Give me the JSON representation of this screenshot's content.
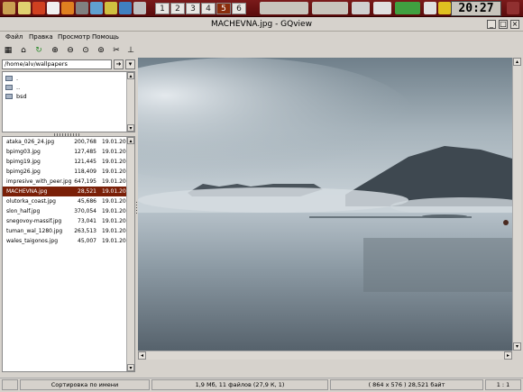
{
  "window_title": "MACHEVNA.jpg - GQview",
  "workspaces": [
    "1",
    "2",
    "3",
    "4",
    "5",
    "6"
  ],
  "active_workspace": "5",
  "clock": "20:27",
  "menu": [
    "Файл",
    "Правка",
    "Просмотр",
    "Помощь"
  ],
  "path": "/home/alv/wallpapers",
  "folders": [
    ".",
    "..",
    "bsd"
  ],
  "files": [
    {
      "name": "ataka_026_24.jpg",
      "size": "200,768",
      "date": "19.01.20"
    },
    {
      "name": "bpimg03.jpg",
      "size": "127,485",
      "date": "19.01.20"
    },
    {
      "name": "bpimg19.jpg",
      "size": "121,445",
      "date": "19.01.20"
    },
    {
      "name": "bpimg26.jpg",
      "size": "118,409",
      "date": "19.01.20"
    },
    {
      "name": "impresive_with_peer.jpg",
      "size": "647,195",
      "date": "19.01.20"
    },
    {
      "name": "MACHEVNA.jpg",
      "size": "28,521",
      "date": "19.01.20"
    },
    {
      "name": "olutorka_coast.jpg",
      "size": "45,686",
      "date": "19.01.20"
    },
    {
      "name": "slon_half.jpg",
      "size": "370,054",
      "date": "19.01.20"
    },
    {
      "name": "snegovoy-massif.jpg",
      "size": "73,041",
      "date": "19.01.20"
    },
    {
      "name": "tuman_wal_1280.jpg",
      "size": "263,513",
      "date": "19.01.20"
    },
    {
      "name": "wales_taigonos.jpg",
      "size": "45,007",
      "date": "19.01.20"
    }
  ],
  "selected_file": "MACHEVNA.jpg",
  "status": {
    "sort": "Сортировка по имени",
    "summary": "1,9 Мб, 11 файлов (27,9 К, 1)",
    "image_info": "( 864 x 576 ) 28,521 байт",
    "zoom": "1 : 1"
  },
  "colors": {
    "panel": "#6a1414",
    "selection": "#7a2008",
    "window": "#d6d2cc"
  }
}
